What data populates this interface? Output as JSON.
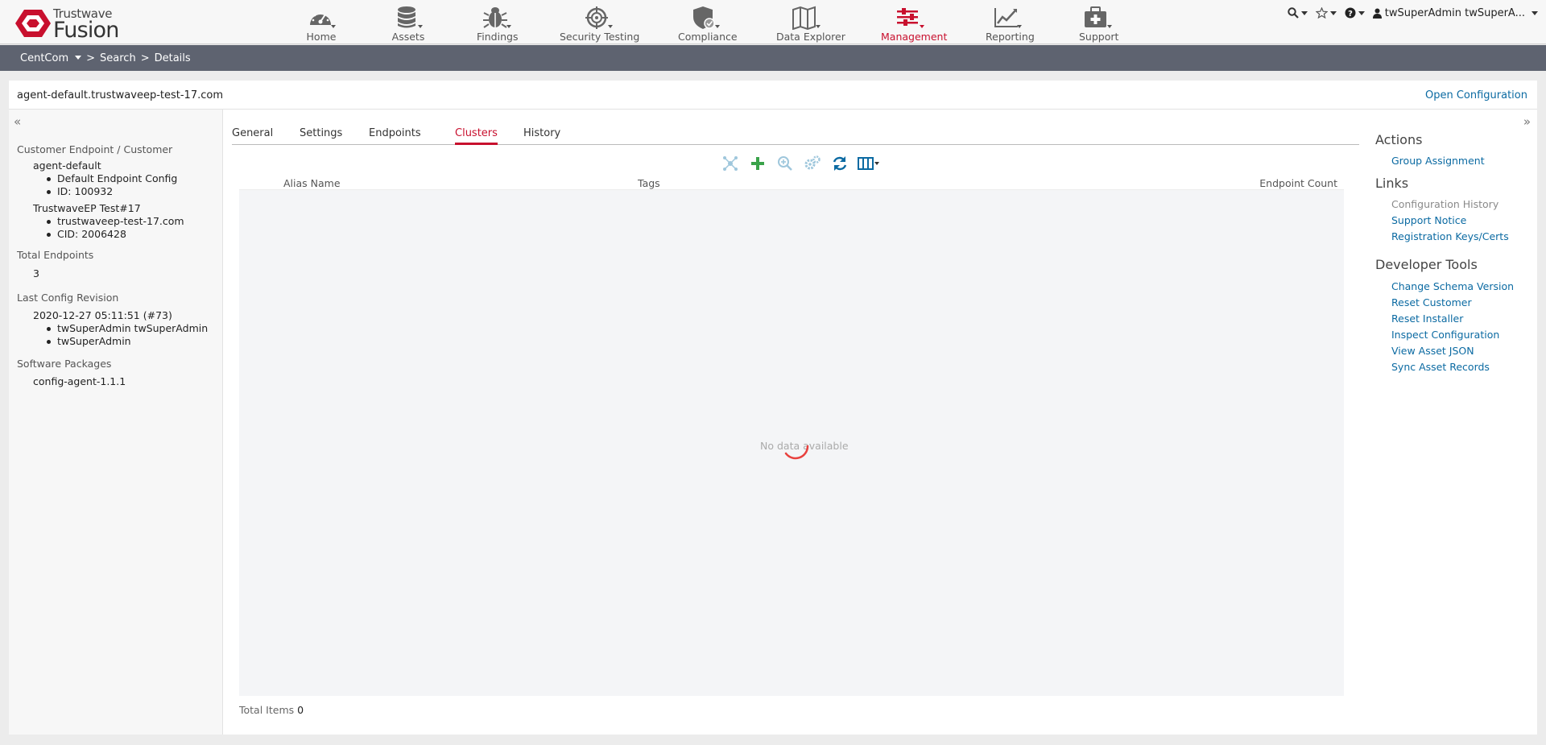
{
  "brand": {
    "company": "Trustwave",
    "product": "Fusion"
  },
  "nav": {
    "items": [
      {
        "label": "Home",
        "icon": "dashboard-gauge-icon"
      },
      {
        "label": "Assets",
        "icon": "database-icon"
      },
      {
        "label": "Findings",
        "icon": "bug-icon"
      },
      {
        "label": "Security Testing",
        "icon": "crosshair-target-icon"
      },
      {
        "label": "Compliance",
        "icon": "shield-check-icon"
      },
      {
        "label": "Data Explorer",
        "icon": "map-icon"
      },
      {
        "label": "Management",
        "icon": "sliders-icon",
        "active": true
      },
      {
        "label": "Reporting",
        "icon": "line-chart-icon"
      },
      {
        "label": "Support",
        "icon": "first-aid-kit-icon"
      }
    ],
    "user": "twSuperAdmin twSuperA...",
    "active_color": "#c8102e"
  },
  "breadcrumb": {
    "root": "CentCom",
    "sep1": ">",
    "search": "Search",
    "sep2": ">",
    "details": "Details"
  },
  "asset": {
    "name": "agent-default.trustwaveep-test-17.com",
    "open_config": "Open Configuration"
  },
  "left": {
    "customer_title": "Customer Endpoint / Customer",
    "endpoint_name": "agent-default",
    "endpoint_config": "Default Endpoint Config",
    "endpoint_id": "ID: 100932",
    "customer_name": "TrustwaveEP Test#17",
    "customer_domain": "trustwaveep-test-17.com",
    "customer_cid": "CID: 2006428",
    "total_endpoints_title": "Total Endpoints",
    "total_endpoints": "3",
    "last_config_title": "Last Config Revision",
    "last_config_date": "2020-12-27 05:11:51 (#73)",
    "last_config_user1": "twSuperAdmin twSuperAdmin",
    "last_config_user2": "twSuperAdmin",
    "software_title": "Software Packages",
    "software_pkg": "config-agent-1.1.1"
  },
  "tabs": [
    "General",
    "Settings",
    "Endpoints",
    "Clusters",
    "History"
  ],
  "active_tab": "Clusters",
  "toolbar": {
    "icons": [
      "cluster-nodes-icon",
      "plus-icon",
      "zoom-in-icon",
      "gears-icon",
      "refresh-icon",
      "columns-icon"
    ]
  },
  "grid": {
    "columns": [
      "Alias Name",
      "Tags",
      "Endpoint Count"
    ],
    "empty_text": "No data available",
    "total_label": "Total Items",
    "total_value": "0"
  },
  "right": {
    "actions_title": "Actions",
    "actions": [
      "Group Assignment"
    ],
    "links_title": "Links",
    "links": [
      "Configuration History",
      "Support Notice",
      "Registration Keys/Certs"
    ],
    "dev_title": "Developer Tools",
    "dev_tools": [
      "Change Schema Version",
      "Reset Customer",
      "Reset Installer",
      "Inspect Configuration",
      "View Asset JSON",
      "Sync Asset Records"
    ]
  },
  "colors": {
    "link": "#0b6aa2",
    "breadcrumb_bg": "#5e6370",
    "accent": "#c8102e",
    "add_green": "#3aa34a"
  }
}
